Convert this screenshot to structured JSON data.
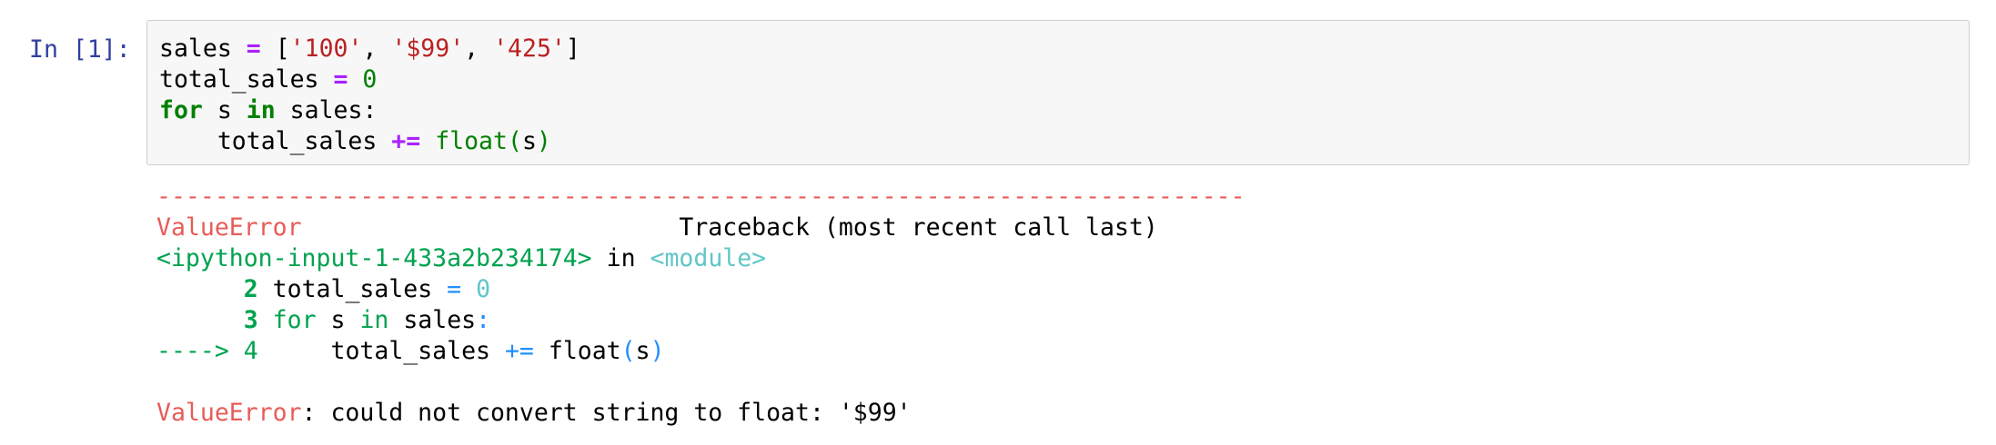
{
  "cell": {
    "prompt": "In [1]:",
    "code": {
      "line1": {
        "var": "sales",
        "op": "=",
        "open": "[",
        "s1": "'100'",
        "sep1": ",",
        "s2": "'$99'",
        "sep2": ",",
        "s3": "'425'",
        "close": "]"
      },
      "line2": {
        "var": "total_sales",
        "op": "=",
        "num": "0"
      },
      "line3": {
        "kw_for": "for",
        "var": "s",
        "kw_in": "in",
        "iter": "sales:"
      },
      "line4": {
        "indent": "    ",
        "var": "total_sales",
        "op": "+=",
        "fn": "float",
        "lparen": "(",
        "arg": "s",
        "rparen": ")"
      }
    }
  },
  "output": {
    "dashes": "---------------------------------------------------------------------------",
    "header": {
      "error_name": "ValueError",
      "gap": "                          ",
      "traceback_label": "Traceback (most recent call last)"
    },
    "location": {
      "source": "<ipython-input-1-433a2b234174>",
      "in_word": "in",
      "module": "<module>"
    },
    "frame_lines": [
      {
        "prefix": "      ",
        "lineno": "2",
        "text": "total_sales",
        "op": "=",
        "num": "0"
      },
      {
        "prefix": "      ",
        "lineno": "3",
        "kw_for": "for",
        "var": "s",
        "kw_in": "in",
        "iter": "sales",
        "colon": ":"
      },
      {
        "arrow": "---->",
        "lineno": "4",
        "indent": "     ",
        "text": "total_sales",
        "op": "+=",
        "fn": "float",
        "lparen": "(",
        "arg": "s",
        "rparen": ")"
      }
    ],
    "final": {
      "error_name": "ValueError",
      "message": ": could not convert string to float: '$99'"
    }
  },
  "colors": {
    "prompt": "#303f9f",
    "error": "#e75c58",
    "traceback_green": "#00a250",
    "traceback_cyan": "#60c6c8",
    "traceback_blue": "#208ffb",
    "keyword": "#008000",
    "operator": "#aa22ff",
    "string": "#ba2121",
    "input_bg": "#f7f7f7"
  }
}
